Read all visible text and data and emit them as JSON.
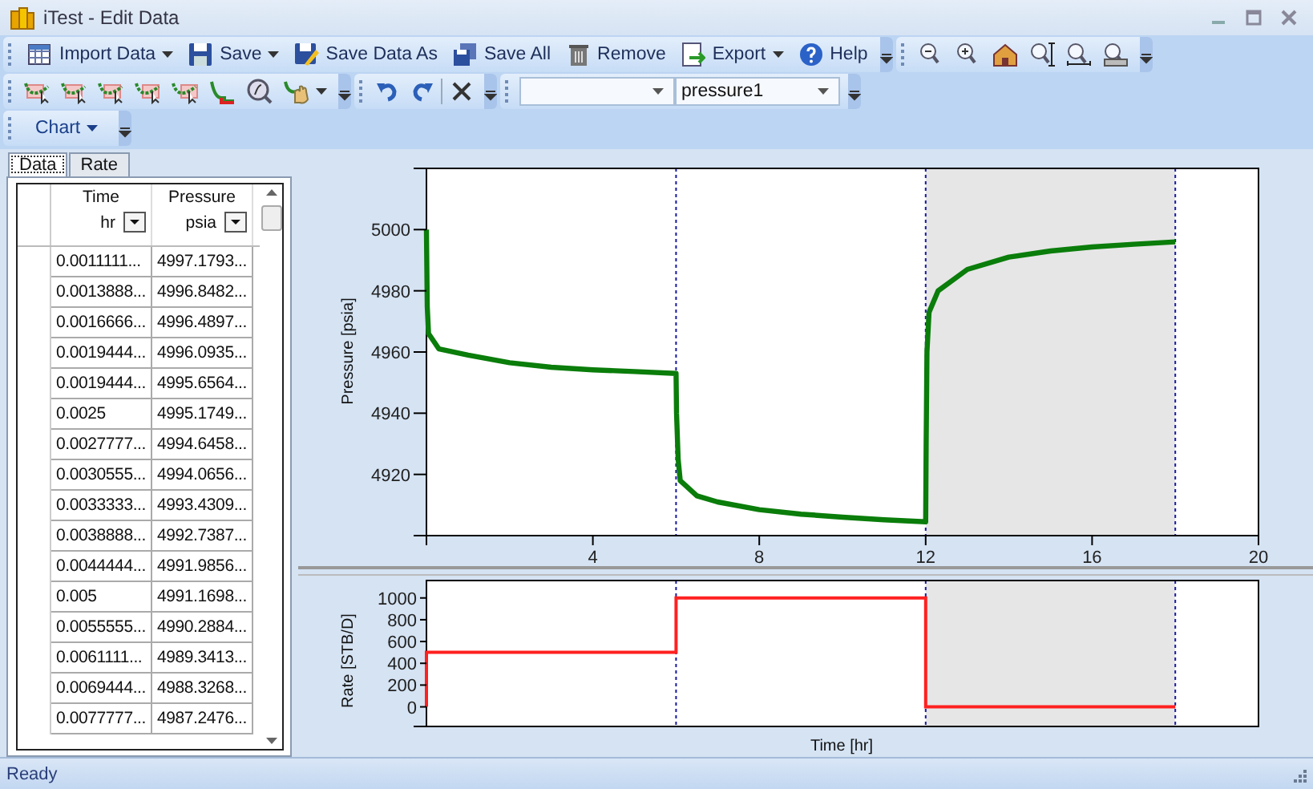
{
  "window": {
    "title": "iTest - Edit Data"
  },
  "main_toolbar": [
    {
      "label": "Import Data",
      "dropdown": true
    },
    {
      "label": "Save",
      "dropdown": true
    },
    {
      "label": "Save Data As",
      "dropdown": false
    },
    {
      "label": "Save All",
      "dropdown": false
    },
    {
      "label": "Remove",
      "dropdown": false
    },
    {
      "label": "Export",
      "dropdown": true
    },
    {
      "label": "Help",
      "dropdown": false
    }
  ],
  "series_selector": {
    "value": "pressure1"
  },
  "chart_menu": {
    "label": "Chart"
  },
  "tabs": [
    {
      "label": "Data",
      "selected": true
    },
    {
      "label": "Rate",
      "selected": false
    }
  ],
  "grid": {
    "columns": [
      {
        "name": "Time",
        "unit": "hr"
      },
      {
        "name": "Pressure",
        "unit": "psia"
      }
    ],
    "rows": [
      [
        "0.0011111...",
        "4997.1793..."
      ],
      [
        "0.0013888...",
        "4996.8482..."
      ],
      [
        "0.0016666...",
        "4996.4897..."
      ],
      [
        "0.0019444...",
        "4996.0935..."
      ],
      [
        "0.0019444...",
        "4995.6564..."
      ],
      [
        "0.0025",
        "4995.1749..."
      ],
      [
        "0.0027777...",
        "4994.6458..."
      ],
      [
        "0.0030555...",
        "4994.0656..."
      ],
      [
        "0.0033333...",
        "4993.4309..."
      ],
      [
        "0.0038888...",
        "4992.7387..."
      ],
      [
        "0.0044444...",
        "4991.9856..."
      ],
      [
        "0.005",
        "4991.1698..."
      ],
      [
        "0.0055555...",
        "4990.2884..."
      ],
      [
        "0.0061111...",
        "4989.3413..."
      ],
      [
        "0.0069444...",
        "4988.3268..."
      ],
      [
        "0.0077777...",
        "4987.2476..."
      ]
    ]
  },
  "pressure_chart": {
    "chart_data": {
      "type": "line",
      "ylabel": "Pressure [psia]",
      "xlim": [
        0,
        20
      ],
      "ylim": [
        4900,
        5020
      ],
      "xticks": [
        4,
        8,
        12,
        16,
        20
      ],
      "yticks": [
        4920,
        4940,
        4960,
        4980,
        5000
      ],
      "x": [
        0,
        0.02,
        0.05,
        0.3,
        1,
        2,
        3,
        4,
        5,
        6,
        6.01,
        6.05,
        6.1,
        6.5,
        7,
        8,
        9,
        10,
        11,
        12,
        12.01,
        12.03,
        12.08,
        12.3,
        13,
        14,
        15,
        16,
        17,
        18
      ],
      "series": [
        {
          "color": "#0a7d0a",
          "values": [
            5000,
            4975,
            4966,
            4961,
            4959,
            4956.5,
            4955,
            4954.2,
            4953.6,
            4953,
            4940,
            4925,
            4918,
            4913,
            4911,
            4908.5,
            4907,
            4906,
            4905.2,
            4904.5,
            4930,
            4960,
            4973,
            4980,
            4987,
            4991,
            4993,
            4994.3,
            4995.2,
            4996
          ]
        }
      ],
      "ref_lines": [
        {
          "axis": "x",
          "value": 6
        },
        {
          "axis": "x",
          "value": 12
        },
        {
          "axis": "x",
          "value": 18
        }
      ],
      "bands": [
        {
          "axis": "x",
          "from": 12,
          "to": 18
        }
      ]
    }
  },
  "rate_chart": {
    "chart_data": {
      "type": "line",
      "xlabel": "Time [hr]",
      "ylabel": "Rate [STB/D]",
      "xlim": [
        0,
        20
      ],
      "ylim": [
        -180,
        1160
      ],
      "yticks": [
        0,
        200,
        400,
        600,
        800,
        1000
      ],
      "x": [
        0,
        0,
        6,
        6,
        12,
        12,
        18
      ],
      "series": [
        {
          "color": "#ff2020",
          "values": [
            0,
            500,
            500,
            1000,
            1000,
            0,
            0
          ]
        }
      ],
      "ref_lines": [
        {
          "axis": "x",
          "value": 6
        },
        {
          "axis": "x",
          "value": 12
        },
        {
          "axis": "x",
          "value": 18
        }
      ],
      "bands": [
        {
          "axis": "x",
          "from": 12,
          "to": 18
        }
      ]
    }
  },
  "status_bar": {
    "text": "Ready"
  }
}
